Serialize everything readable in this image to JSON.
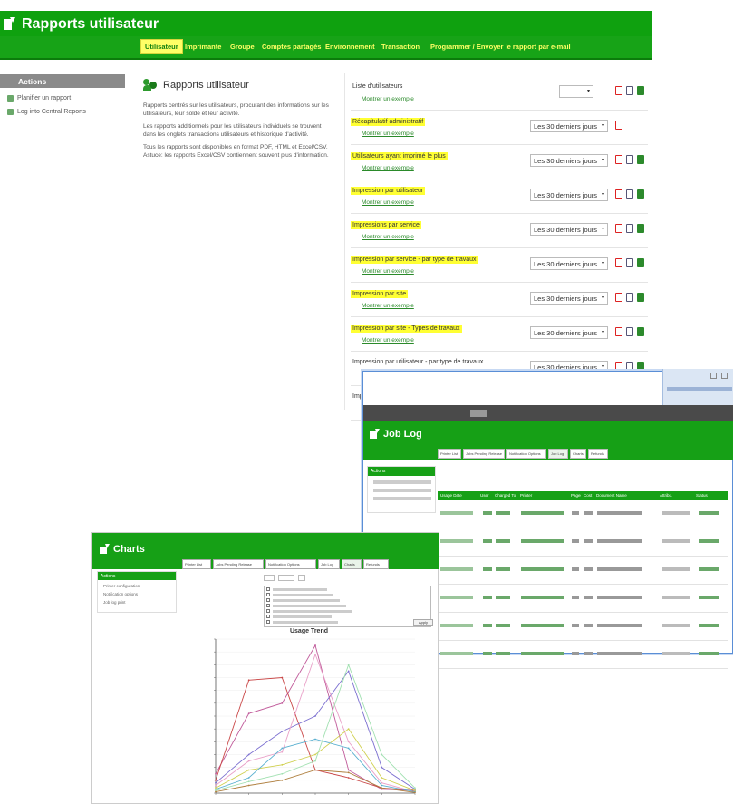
{
  "main": {
    "title": "Rapports utilisateur",
    "tabs": [
      {
        "label": "Utilisateur"
      },
      {
        "label": "Imprimante"
      },
      {
        "label": "Groupe"
      },
      {
        "label": "Comptes partagés"
      },
      {
        "label": "Environnement"
      },
      {
        "label": "Transaction"
      },
      {
        "label": "Programmer / Envoyer le rapport par e-mail"
      }
    ],
    "actions": {
      "title": "Actions",
      "items": [
        "Planifier un rapport",
        "Log into Central Reports"
      ]
    },
    "intro": {
      "title": "Rapports utilisateur",
      "paragraphs": [
        "Rapports centrés sur les utilisateurs, procurant des informations sur les utilisateurs, leur solde et leur activité.",
        "Les rapports additionnels pour les utilisateurs individuels se trouvent dans les onglets transactions utilisateurs et historique d'activité.",
        "Tous les rapports sont disponibles en format PDF, HTML et Excel/CSV. Astuce: les rapports Excel/CSV contiennent souvent plus d'information."
      ]
    },
    "report_link_label": "Montrer un exemple",
    "period_option": "Les 30 derniers jours",
    "reports": [
      {
        "name": "Liste d'utilisateurs",
        "highlight": false,
        "select": "",
        "formats": [
          "pdf",
          "html",
          "csv"
        ]
      },
      {
        "name": "Récapitulatif administratif",
        "highlight": true,
        "select": "Les 30 derniers jours",
        "formats": [
          "pdf"
        ]
      },
      {
        "name": "Utilisateurs ayant imprimé le plus",
        "highlight": true,
        "select": "Les 30 derniers jours",
        "formats": [
          "pdf",
          "html",
          "csv"
        ]
      },
      {
        "name": "Impression par utilisateur",
        "highlight": true,
        "select": "Les 30 derniers jours",
        "formats": [
          "pdf",
          "html",
          "csv"
        ]
      },
      {
        "name": "Impressions par service",
        "highlight": true,
        "select": "Les 30 derniers jours",
        "formats": [
          "pdf",
          "html",
          "csv"
        ]
      },
      {
        "name": "Impression par service - par type de travaux",
        "highlight": true,
        "select": "Les 30 derniers jours",
        "formats": [
          "pdf",
          "html",
          "csv"
        ]
      },
      {
        "name": "Impression par site",
        "highlight": true,
        "select": "Les 30 derniers jours",
        "formats": [
          "pdf",
          "html",
          "csv"
        ]
      },
      {
        "name": "Impression par site - Types de travaux",
        "highlight": true,
        "select": "Les 30 derniers jours",
        "formats": [
          "pdf",
          "html",
          "csv"
        ]
      },
      {
        "name": "Impression par utilisateur - par type de travaux",
        "highlight": false,
        "select": "Les 30 derniers jours",
        "formats": [
          "pdf",
          "html",
          "csv"
        ]
      },
      {
        "name": "Impression par utilisateur - par imprimante",
        "highlight": false,
        "select": "Les 30 derniers jours",
        "formats": [
          "pdf",
          "html",
          "csv"
        ]
      }
    ]
  },
  "job_log": {
    "title": "Job Log",
    "tabs": [
      "Printer List",
      "Jobs Pending Release",
      "Notification Options",
      "Job Log",
      "Charts",
      "Refunds"
    ],
    "actions_title": "Actions",
    "table_headers": [
      "Usage Date",
      "User",
      "Charged To",
      "Printer",
      "Pages",
      "Cost",
      "Document Name",
      "Attribs.",
      "Status"
    ]
  },
  "charts": {
    "title": "Charts",
    "tabs": [
      "Printer List",
      "Jobs Pending Release",
      "Notification Options",
      "Job Log",
      "Charts",
      "Refunds"
    ],
    "actions_title": "Actions",
    "actions": [
      "Printer configuration",
      "Notification options",
      "Job log print"
    ],
    "apply_label": "Apply",
    "chart": {
      "title": "Usage Trend"
    }
  },
  "chart_data": {
    "type": "line",
    "title": "Usage Trend",
    "ylim": [
      0,
      1200
    ],
    "series": [
      {
        "values": [
          150,
          620,
          700,
          1150,
          180,
          30,
          20
        ],
        "color": "#c05a9a"
      },
      {
        "values": [
          100,
          880,
          900,
          180,
          120,
          40,
          20
        ],
        "color": "#c94646"
      },
      {
        "values": [
          80,
          300,
          480,
          600,
          950,
          200,
          30
        ],
        "color": "#7b6fd0"
      },
      {
        "values": [
          60,
          250,
          320,
          1080,
          400,
          80,
          10
        ],
        "color": "#e9a0c8"
      },
      {
        "values": [
          40,
          180,
          220,
          300,
          500,
          120,
          20
        ],
        "color": "#d0d050"
      },
      {
        "values": [
          30,
          120,
          350,
          420,
          350,
          60,
          10
        ],
        "color": "#5ab0d0"
      },
      {
        "values": [
          20,
          90,
          150,
          250,
          1000,
          300,
          40
        ],
        "color": "#a0e0b0"
      },
      {
        "values": [
          10,
          60,
          100,
          180,
          160,
          40,
          5
        ],
        "color": "#b08040"
      }
    ]
  }
}
